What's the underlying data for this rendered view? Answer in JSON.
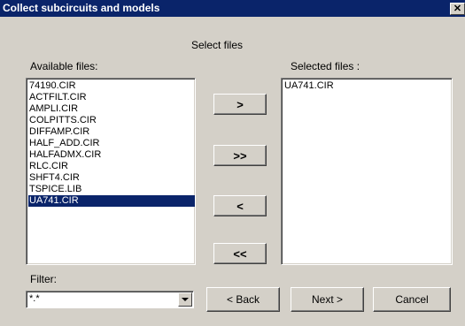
{
  "window": {
    "title": "Collect subcircuits and models",
    "close_glyph": "✕"
  },
  "header": {
    "select_files": "Select files"
  },
  "available": {
    "label": "Available files:",
    "items": [
      "74190.CIR",
      "ACTFILT.CIR",
      "AMPLI.CIR",
      "COLPITTS.CIR",
      "DIFFAMP.CIR",
      "HALF_ADD.CIR",
      "HALFADMX.CIR",
      "RLC.CIR",
      "SHFT4.CIR",
      "TSPICE.LIB",
      "UA741.CIR"
    ],
    "selected_item": "UA741.CIR"
  },
  "selected": {
    "label": "Selected files :",
    "items": [
      "UA741.CIR"
    ]
  },
  "transfer_buttons": {
    "add": ">",
    "add_all": ">>",
    "remove": "<",
    "remove_all": "<<"
  },
  "filter": {
    "label": "Filter:",
    "value": "*.*"
  },
  "footer": {
    "back": "< Back",
    "next": "Next >",
    "cancel": "Cancel"
  },
  "colors": {
    "title_bar": "#0a246a",
    "face": "#d4d0c8",
    "selection": "#0a246a"
  },
  "icons": {
    "close": "close-icon",
    "dropdown": "chevron-down-icon"
  }
}
